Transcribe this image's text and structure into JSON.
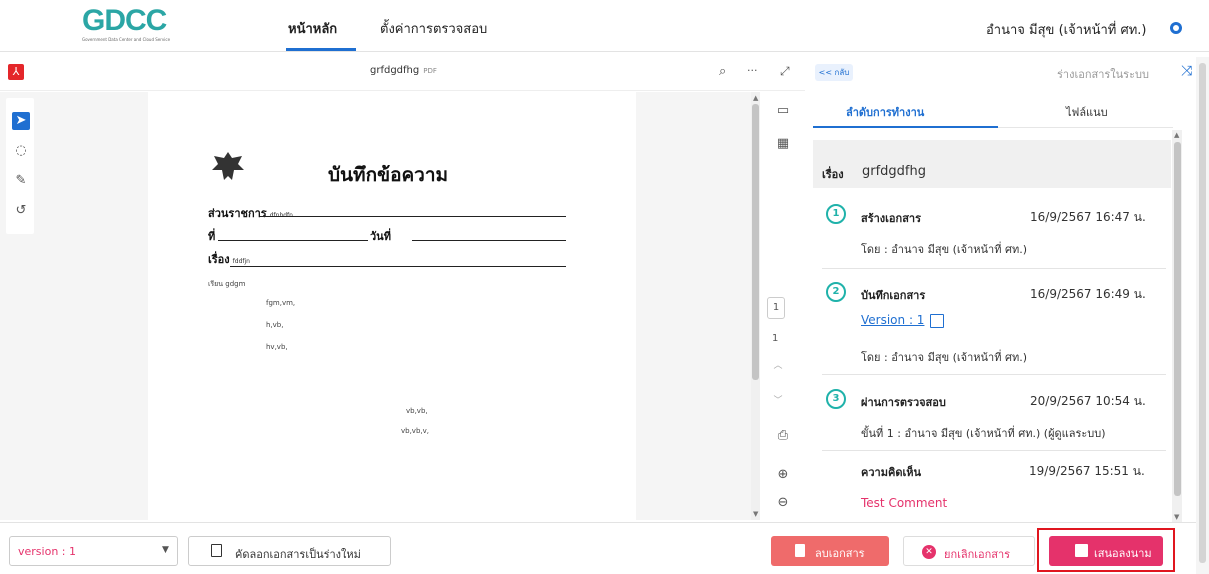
{
  "header": {
    "logo_text": "GDCC",
    "logo_subtitle": "Government Data Center and Cloud Service",
    "nav_home": "หน้าหลัก",
    "nav_settings": "ตั้งค่าการตรวจสอบ",
    "user_name": "อำนาจ มีสุข (เจ้าหน้าที่ ศท.)"
  },
  "viewer": {
    "file_name": "grfdgdfhg",
    "file_type": "PDF",
    "current_page": "1",
    "total_pages": "1"
  },
  "document": {
    "title": "บันทึกข้อความ",
    "agency_label": "ส่วนราชการ",
    "agency_value": "dfnhdfn",
    "ref_label": "ที่",
    "date_label": "วันที่",
    "subject_label": "เรื่อง",
    "subject_value": "fddfjn",
    "to_line": "เรียน  gdgm",
    "body_lines": [
      "fgm,vm,",
      "h,vb,",
      "hv,vb,"
    ],
    "body_lines2": [
      "vb,vb,",
      "vb,vb,v,"
    ]
  },
  "right_panel": {
    "back_label": "<< กลับ",
    "status_label": "ร่างเอกสารในระบบ",
    "tabs": [
      "ลำดับการทำงาน",
      "ไฟล์แนบ"
    ],
    "subject_label": "เรื่อง",
    "subject_value": "grfdgdfhg",
    "steps": [
      {
        "num": "1",
        "title": "สร้างเอกสาร",
        "date": "16/9/2567 16:47 น.",
        "by": "โดย : อำนาจ มีสุข (เจ้าหน้าที่ ศท.)"
      },
      {
        "num": "2",
        "title": "บันทึกเอกสาร",
        "date": "16/9/2567 16:49 น.",
        "link": "Version : 1",
        "by": "โดย : อำนาจ มีสุข (เจ้าหน้าที่ ศท.)"
      },
      {
        "num": "3",
        "title": "ผ่านการตรวจสอบ",
        "date": "20/9/2567 10:54 น.",
        "by": "ขั้นที่ 1 : อำนาจ มีสุข (เจ้าหน้าที่ ศท.) (ผู้ดูแลระบบ)"
      }
    ],
    "comment_label": "ความคิดเห็น",
    "comment_date": "19/9/2567 15:51 น.",
    "comment_value": "Test Comment"
  },
  "footer": {
    "version_select": "version : 1",
    "copy_button": "คัดลอกเอกสารเป็นร่างใหม่",
    "delete_button": "ลบเอกสาร",
    "cancel_button": "ยกเลิกเอกสาร",
    "sign_button": "เสนอลงนาม"
  },
  "colors": {
    "accent": "#1f6fd1",
    "teal": "#1fb2aa",
    "pink": "#e5326b",
    "danger": "#ef6b6b",
    "highlight": "#e0161f"
  }
}
